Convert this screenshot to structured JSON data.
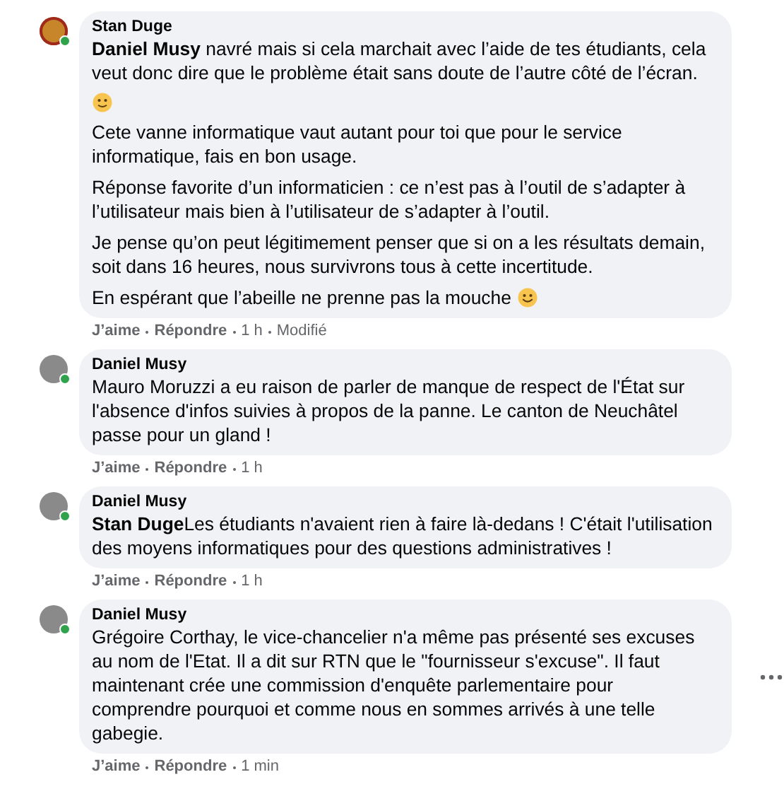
{
  "comments": [
    {
      "author": "Stan Duge",
      "avatar": {
        "kind": "emblem"
      },
      "online": true,
      "paragraphs": [
        {
          "kind": "text",
          "text": "**Daniel Musy** navré mais si cela marchait avec l’aide de tes étudiants, cela veut donc dire que le problème était sans doute de l’autre côté de l’écran.",
          "emoji": false
        },
        {
          "kind": "emoji"
        },
        {
          "kind": "text",
          "text": "Cete vanne informatique vaut autant pour toi que pour le service informatique, fais en bon usage.",
          "emoji": false
        },
        {
          "kind": "text",
          "text": "Réponse favorite d’un informaticien : ce n’est pas à l’outil de s’adapter à l’utilisateur mais bien à l’utilisateur de s’adapter à l’outil.",
          "emoji": false
        },
        {
          "kind": "text",
          "text": "Je pense qu’on peut légitimement penser que si on a les résultats demain, soit dans 16 heures, nous survivrons tous à cette incertitude.",
          "emoji": false
        },
        {
          "kind": "text",
          "text": "En espérant que l’abeille ne prenne pas la mouche",
          "emoji": true
        }
      ],
      "actions": {
        "like": "J’aime",
        "reply": "Répondre",
        "time": "1 h",
        "edited": "Modifié"
      }
    },
    {
      "author": "Daniel Musy",
      "avatar": {
        "kind": "photo"
      },
      "online": true,
      "paragraphs": [
        {
          "kind": "text",
          "text": "Mauro Moruzzi a eu raison de parler de manque de respect de l'État sur l'absence d'infos suivies à propos de la panne. Le canton de Neuchâtel passe pour un gland !",
          "emoji": false
        }
      ],
      "actions": {
        "like": "J’aime",
        "reply": "Répondre",
        "time": "1 h"
      }
    },
    {
      "author": "Daniel Musy",
      "avatar": {
        "kind": "photo"
      },
      "online": true,
      "paragraphs": [
        {
          "kind": "text",
          "text": "**Stan Duge**Les étudiants n'avaient rien à faire là-dedans ! C'était l'utilisation des moyens informatiques pour des questions administratives !",
          "emoji": false
        }
      ],
      "actions": {
        "like": "J’aime",
        "reply": "Répondre",
        "time": "1 h"
      }
    },
    {
      "author": "Daniel Musy",
      "avatar": {
        "kind": "photo"
      },
      "online": true,
      "paragraphs": [
        {
          "kind": "text",
          "text": "Grégoire Corthay, le vice-chancelier n'a même pas présenté ses excuses au nom de l'Etat. Il a dit sur RTN que le \"fournisseur s'excuse\". Il faut maintenant crée une commission d'enquête parlementaire pour comprendre pourquoi et comme nous en sommes arrivés à une telle gabegie.",
          "emoji": false
        }
      ],
      "actions": {
        "like": "J’aime",
        "reply": "Répondre",
        "time": "1 min"
      },
      "more": true
    }
  ]
}
